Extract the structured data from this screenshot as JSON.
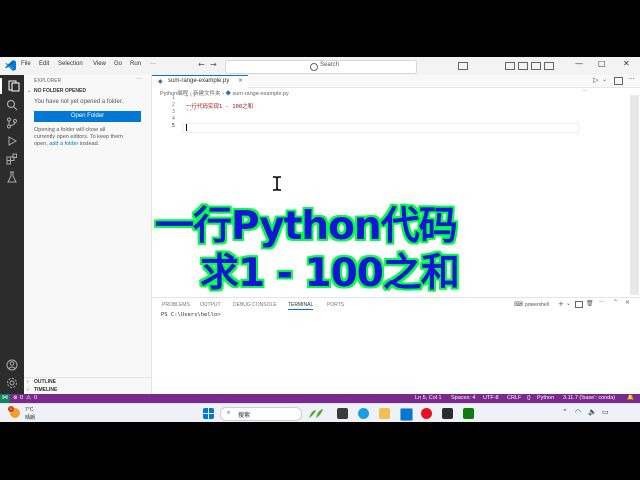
{
  "titlebar": {
    "menus": [
      "File",
      "Edit",
      "Selection",
      "View",
      "Go",
      "Run",
      "···"
    ],
    "search_placeholder": "Search"
  },
  "sidebar": {
    "title": "EXPLORER",
    "section": "NO FOLDER OPENED",
    "message": "You have not yet opened a folder.",
    "open_folder_label": "Open Folder",
    "hint_line1": "Opening a folder will close all",
    "hint_line2": "currently open editors. To keep them",
    "hint_line3_before": "open, ",
    "hint_link": "add a folder",
    "hint_line3_after": " instead.",
    "outline": "OUTLINE",
    "timeline": "TIMELINE"
  },
  "editor": {
    "tab_label": "sum-range-example.py",
    "breadcrumbs": [
      "Python编程",
      "新建文件夹",
      "sum-range-example.py"
    ],
    "line_numbers": [
      "1",
      "2",
      "3",
      "4",
      "5"
    ],
    "lines": [
      "'''",
      "一行代码实现1 - 100之和",
      "'''",
      "",
      ""
    ]
  },
  "overlay": {
    "line1": "一行Python代码",
    "line2": "求1 - 100之和"
  },
  "panel": {
    "tabs": [
      "PROBLEMS",
      "OUTPUT",
      "DEBUG CONSOLE",
      "TERMINAL",
      "PORTS"
    ],
    "active_tab": "TERMINAL",
    "terminal_name": "powershell",
    "prompt": "PS C:\\Users\\hello>"
  },
  "statusbar": {
    "errors": "0",
    "warnings": "0",
    "position": "Ln 5, Col 1",
    "spaces": "Spaces: 4",
    "encoding": "UTF-8",
    "eol": "CRLF",
    "language": "Python",
    "interpreter": "3.11.7 ('base': conda)"
  },
  "taskbar": {
    "weather_temp": "7°C",
    "weather_desc": "晴朗",
    "search_label": "搜索",
    "notification_count": "1"
  },
  "colors": {
    "accent": "#0078d4",
    "statusbar": "#7a2a8a",
    "overlay_fill": "#1515d8",
    "overlay_outline": "#00ff40"
  }
}
